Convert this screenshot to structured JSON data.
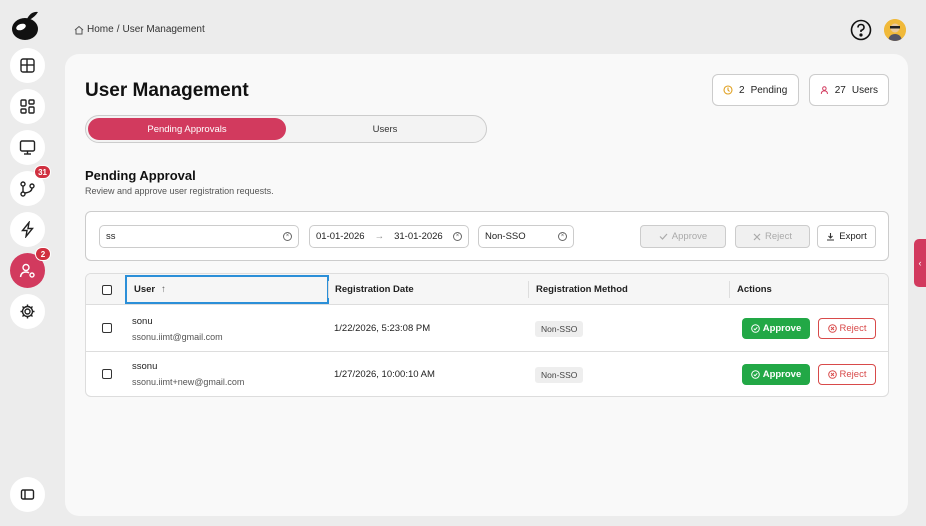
{
  "breadcrumb": {
    "home": "Home",
    "separator": "/",
    "current": "User Management"
  },
  "sidebar": {
    "items": [
      {
        "name": "dashboard-grid-icon",
        "badge": ""
      },
      {
        "name": "widgets-icon",
        "badge": ""
      },
      {
        "name": "monitor-icon",
        "badge": ""
      },
      {
        "name": "workflow-icon",
        "badge": "31"
      },
      {
        "name": "lightning-icon",
        "badge": ""
      },
      {
        "name": "user-management-icon",
        "badge": "2"
      },
      {
        "name": "settings-icon",
        "badge": ""
      }
    ]
  },
  "page": {
    "title": "User Management"
  },
  "stats": {
    "pending_count": "2",
    "pending_label": "Pending",
    "users_count": "27",
    "users_label": "Users"
  },
  "tabs": [
    {
      "label": "Pending Approvals",
      "active": true
    },
    {
      "label": "Users",
      "active": false
    }
  ],
  "section": {
    "title": "Pending Approval",
    "subtitle": "Review and approve user registration requests."
  },
  "filters": {
    "search_value": "ss",
    "date_from": "01-01-2026",
    "date_arrow": "→",
    "date_to": "31-01-2026",
    "method_value": "Non-SSO",
    "approve_label": "Approve",
    "reject_label": "Reject",
    "export_label": "Export"
  },
  "table": {
    "headers": [
      "User",
      "Registration Date",
      "Registration Method",
      "Actions"
    ],
    "sort_arrow": "↑",
    "rows": [
      {
        "name": "sonu",
        "email": "ssonu.iimt@gmail.com",
        "date": "1/22/2026, 5:23:08 PM",
        "method": "Non-SSO",
        "approve": "Approve",
        "reject": "Reject"
      },
      {
        "name": "ssonu",
        "email": "ssonu.iimt+new@gmail.com",
        "date": "1/27/2026, 10:00:10 AM",
        "method": "Non-SSO",
        "approve": "Approve",
        "reject": "Reject"
      }
    ]
  },
  "colors": {
    "accent": "#d23a5e",
    "approve_green": "#22a846",
    "reject_red": "#d84a4a",
    "focus_blue": "#2b8fd8"
  }
}
